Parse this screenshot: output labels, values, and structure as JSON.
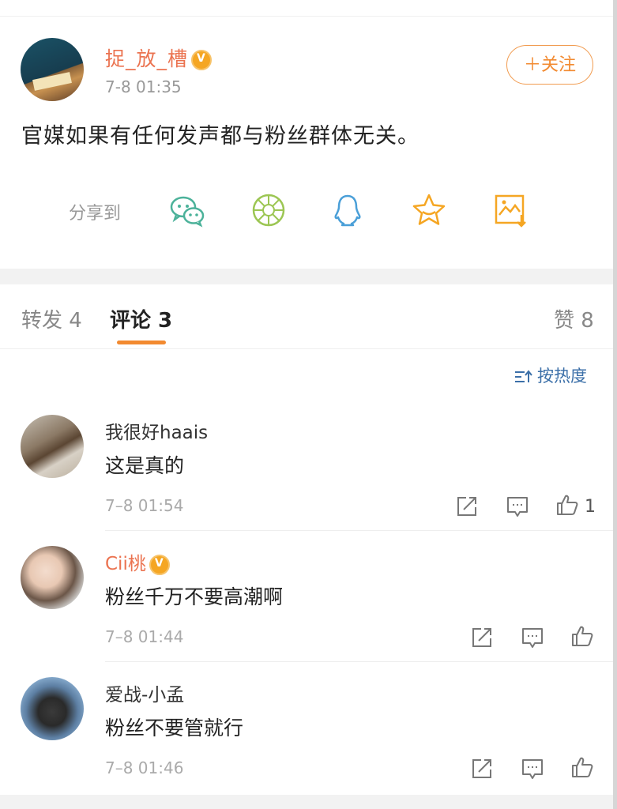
{
  "post": {
    "username": "捉_放_槽",
    "time": "7-8 01:35",
    "follow_label": "＋关注",
    "text": "官媒如果有任何发声都与粉丝群体无关。"
  },
  "share": {
    "label": "分享到",
    "icons": [
      "wechat-icon",
      "moments-icon",
      "qq-icon",
      "favorite-star-icon",
      "save-image-icon"
    ]
  },
  "tabs": {
    "repost": "转发 4",
    "comments": "评论 3",
    "likes": "赞 8"
  },
  "sort": {
    "label": "按热度"
  },
  "comments": [
    {
      "user": "我很好haais",
      "text": "这是真的",
      "time": "7–8 01:54",
      "likes": "1"
    },
    {
      "user": "Cii桃",
      "text": "粉丝千万不要高潮啊",
      "time": "7–8 01:44",
      "likes": ""
    },
    {
      "user": "爱战-小孟",
      "text": "粉丝不要管就行",
      "time": "7–8 01:46",
      "likes": ""
    }
  ],
  "colors": {
    "accent": "#f28a30",
    "username_vip": "#eb7350",
    "sort_link": "#3b6fa8",
    "wechat": "#4cb29a",
    "moments": "#9cc653",
    "qq": "#4a9fd8",
    "star": "#f5a623"
  }
}
